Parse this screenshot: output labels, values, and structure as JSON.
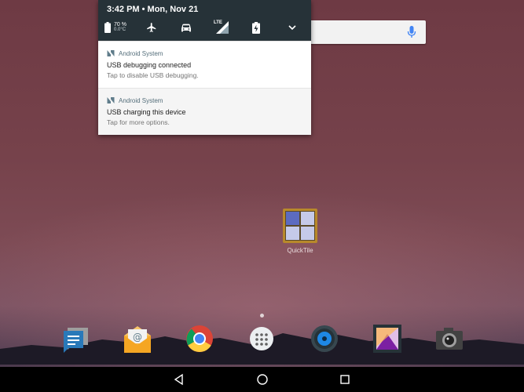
{
  "status_bar": {
    "time_date": "3:42 PM • Mon, Nov 21"
  },
  "quick_settings": {
    "battery_percent": "70 %",
    "battery_temp": "0.0°C",
    "lte_label": "LTE",
    "icons": [
      "battery-icon",
      "airplane-mode-icon",
      "car-icon",
      "lte-signal-icon",
      "battery-saver-icon",
      "expand-chevron-icon"
    ]
  },
  "notifications": [
    {
      "app": "Android System",
      "title": "USB debugging connected",
      "text": "Tap to disable USB debugging."
    },
    {
      "app": "Android System",
      "title": "USB charging this device",
      "text": "Tap for more options."
    }
  ],
  "home": {
    "quicktile_label": "QuickTile",
    "dock": [
      "messages-app-icon",
      "email-app-icon",
      "chrome-app-icon",
      "app-drawer-icon",
      "music-app-icon",
      "gallery-app-icon",
      "camera-app-icon"
    ]
  },
  "colors": {
    "shade_header": "#263238",
    "notification_bg": "#ffffff",
    "accent": "#4285f4"
  }
}
